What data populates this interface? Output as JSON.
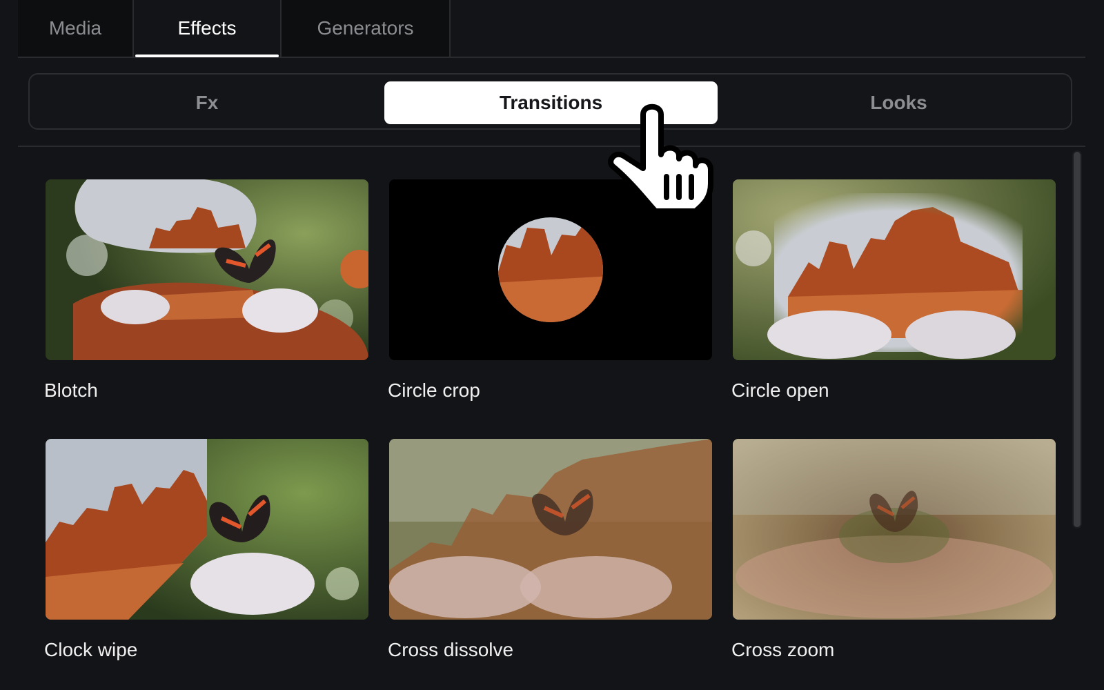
{
  "top_tabs": [
    {
      "label": "Media",
      "active": false
    },
    {
      "label": "Effects",
      "active": true
    },
    {
      "label": "Generators",
      "active": false
    }
  ],
  "segmented": {
    "items": [
      "Fx",
      "Transitions",
      "Looks"
    ],
    "selected": "Transitions"
  },
  "effects": [
    {
      "label": "Blotch"
    },
    {
      "label": "Circle crop"
    },
    {
      "label": "Circle open"
    },
    {
      "label": "Clock wipe"
    },
    {
      "label": "Cross dissolve"
    },
    {
      "label": "Cross zoom"
    }
  ],
  "colors": {
    "background": "#131417",
    "selected_segment": "#ffffff",
    "rock": "#b5562a",
    "foliage": "#4f6a2e",
    "butterfly_orange": "#e2572b"
  },
  "icons": {
    "pointer": "hand-pointer-icon"
  }
}
